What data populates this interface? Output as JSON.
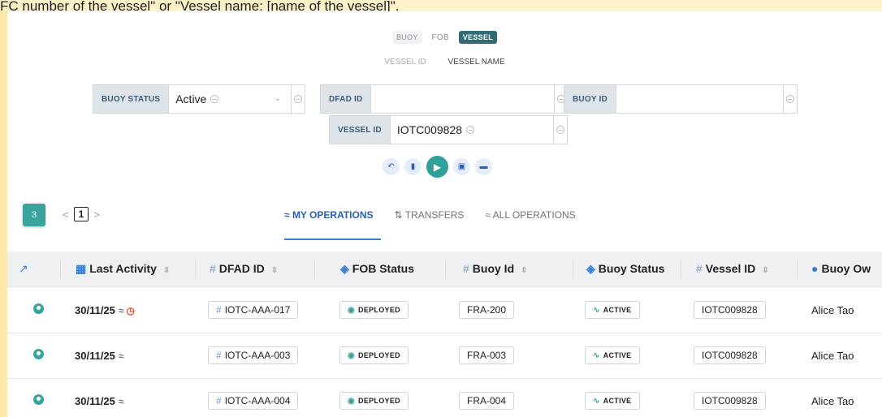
{
  "top_banner": "FC number of the vessel\" or \"Vessel name: [name of the vessel]\".",
  "modes": {
    "buoy": "BUOY",
    "fob": "FOB",
    "vessel": "VESSEL"
  },
  "vessel_tabs": {
    "id": "VESSEL ID",
    "name": "VESSEL NAME"
  },
  "filters": {
    "buoy_status": {
      "label": "BUOY STATUS",
      "value": "Active"
    },
    "dfad_id": {
      "label": "DFAD ID",
      "value": ""
    },
    "buoy_id": {
      "label": "BUOY ID",
      "value": ""
    },
    "vessel_id": {
      "label": "VESSEL ID",
      "value": "IOTC009828"
    }
  },
  "result_count": "3",
  "pagination": {
    "page": "1"
  },
  "view_tabs": {
    "my_operations": "MY OPERATIONS",
    "transfers": "TRANSFERS",
    "all_operations": "ALL OPERATIONS"
  },
  "columns": {
    "last_activity": "Last Activity",
    "dfad_id": "DFAD ID",
    "fob_status": "FOB Status",
    "buoy_id": "Buoy Id",
    "buoy_status": "Buoy Status",
    "vessel_id": "Vessel ID",
    "buoy_owner": "Buoy Ow"
  },
  "rows": [
    {
      "last_activity": "30/11/25",
      "alarm": true,
      "dfad_id": "IOTC-AAA-017",
      "fob_status": "DEPLOYED",
      "buoy_id": "FRA-200",
      "buoy_status": "ACTIVE",
      "vessel_id": "IOTC009828",
      "owner": "Alice Tao"
    },
    {
      "last_activity": "30/11/25",
      "alarm": false,
      "dfad_id": "IOTC-AAA-003",
      "fob_status": "DEPLOYED",
      "buoy_id": "FRA-003",
      "buoy_status": "ACTIVE",
      "vessel_id": "IOTC009828",
      "owner": "Alice Tao"
    },
    {
      "last_activity": "30/11/25",
      "alarm": false,
      "dfad_id": "IOTC-AAA-004",
      "fob_status": "DEPLOYED",
      "buoy_id": "FRA-004",
      "buoy_status": "ACTIVE",
      "vessel_id": "IOTC009828",
      "owner": "Alice Tao"
    }
  ],
  "colors": {
    "accent": "#3aa39c",
    "brand_dark": "#2f6c76",
    "link_blue": "#2b5fb3"
  }
}
